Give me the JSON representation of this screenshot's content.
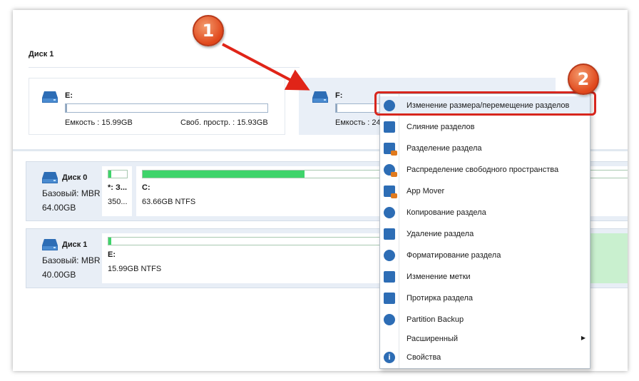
{
  "top_section": {
    "disk_title": "Диск 1",
    "partitions": [
      {
        "name": "E:",
        "capacity": "Емкость : 15.99GB",
        "free": "Своб. простр. : 15.93GB",
        "selected": false
      },
      {
        "name": "F:",
        "capacity": "Емкость : 24",
        "selected": true
      }
    ]
  },
  "disks": [
    {
      "name": "Диск 0",
      "type": "Базовый: MBR",
      "size": "64.00GB",
      "partitions": [
        {
          "label": "*: З...",
          "info": "350...",
          "used_fraction": 0.05
        },
        {
          "label": "C:",
          "info": "63.66GB NTFS",
          "used_fraction": 0.32
        }
      ]
    },
    {
      "name": "Диск 1",
      "type": "Базовый: MBR",
      "size": "40.00GB",
      "partitions": [
        {
          "label": "E:",
          "info": "15.99GB NTFS",
          "used_fraction": 0.01
        }
      ]
    }
  ],
  "context_menu": {
    "items": [
      {
        "label": "Изменение размера/перемещение разделов",
        "icon": "resize-icon",
        "highlighted": true
      },
      {
        "label": "Слияние разделов",
        "icon": "merge-icon"
      },
      {
        "label": "Разделение раздела",
        "icon": "split-icon"
      },
      {
        "label": "Распределение свободного пространства",
        "icon": "allocate-space-icon"
      },
      {
        "label": "App Mover",
        "icon": "app-mover-icon"
      },
      {
        "label": "Копирование раздела",
        "icon": "copy-partition-icon"
      },
      {
        "label": "Удаление раздела",
        "icon": "delete-icon"
      },
      {
        "label": "Форматирование раздела",
        "icon": "format-icon"
      },
      {
        "label": "Изменение метки",
        "icon": "label-tag-icon"
      },
      {
        "label": "Протирка раздела",
        "icon": "wipe-icon"
      },
      {
        "label": "Partition Backup",
        "icon": "backup-icon"
      },
      {
        "label": "Расширенный",
        "icon": "",
        "has_submenu": true
      },
      {
        "label": "Свойства",
        "icon": "info-icon"
      }
    ]
  },
  "annotations": {
    "badge_1": "1",
    "badge_2": "2",
    "accent_color": "#d7261d"
  }
}
